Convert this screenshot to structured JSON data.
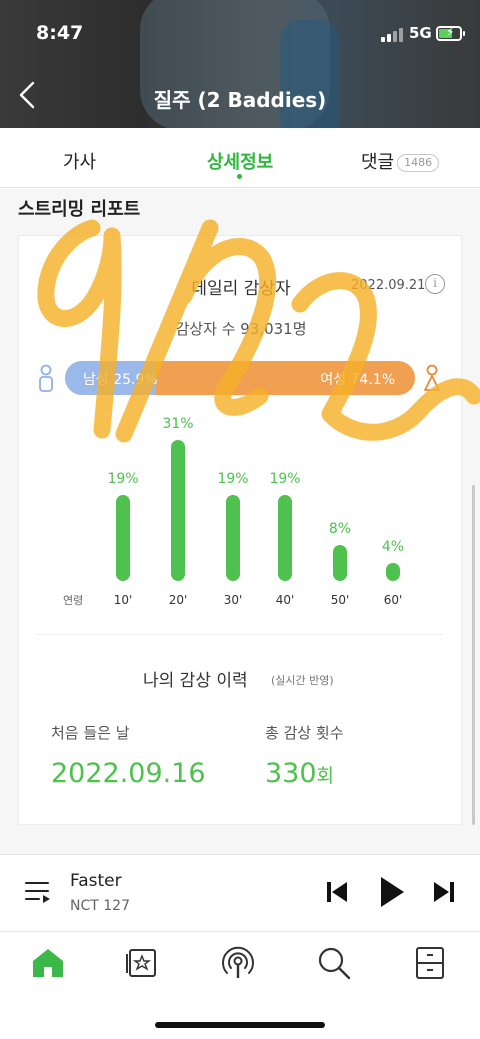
{
  "status": {
    "time": "8:47",
    "network": "5G"
  },
  "header": {
    "title": "질주 (2 Baddies)"
  },
  "tabs": {
    "lyrics": "가사",
    "details": "상세정보",
    "comments": "댓글",
    "comment_count": "1486"
  },
  "section_title": "스트리밍 리포트",
  "daily": {
    "title": "데일리 감상자",
    "date": "2022.09.21",
    "info_glyph": "i",
    "listeners": "감상자 수 93,031명",
    "male_label": "남성 25.9%",
    "female_label": "여성 74.1%",
    "male_share": 25.9,
    "female_share": 74.1,
    "male_color": "#9bb8ea",
    "female_color": "#f0a050"
  },
  "chart_data": {
    "type": "bar",
    "xlabel": "연령",
    "categories": [
      "10'",
      "20'",
      "30'",
      "40'",
      "50'",
      "60'"
    ],
    "values": [
      19,
      31,
      19,
      19,
      8,
      4
    ],
    "labels": [
      "19%",
      "31%",
      "19%",
      "19%",
      "8%",
      "4%"
    ],
    "color": "#4ec14e"
  },
  "my_history": {
    "title": "나의 감상 이력",
    "subtitle": "(실시간 반영)",
    "first_label": "처음 들은 날",
    "first_value": "2022.09.16",
    "count_label": "총 감상 횟수",
    "count_value": "330",
    "count_unit": "회"
  },
  "player": {
    "song": "Faster",
    "artist": "NCT 127"
  },
  "nav": [
    "home-icon",
    "music-card-icon",
    "podcast-icon",
    "search-icon",
    "storage-icon"
  ],
  "accent": "#2fb73f",
  "scribble_color": "#f5b12a"
}
